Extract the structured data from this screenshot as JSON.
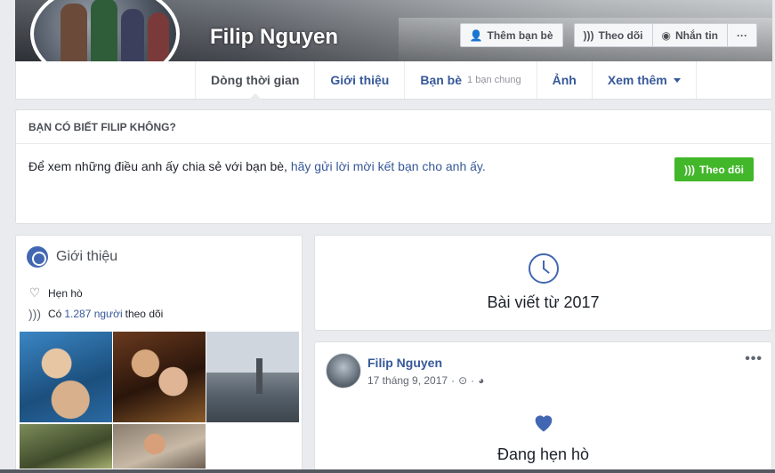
{
  "profile": {
    "name": "Filip Nguyen",
    "actions": {
      "add_friend": "Thêm bạn bè",
      "follow": "Theo dõi",
      "message": "Nhắn tin",
      "more": "···"
    }
  },
  "tabs": [
    {
      "label": "Dòng thời gian",
      "sub": ""
    },
    {
      "label": "Giới thiệu",
      "sub": ""
    },
    {
      "label": "Bạn bè",
      "sub": "1 bạn chung"
    },
    {
      "label": "Ảnh",
      "sub": ""
    },
    {
      "label": "Xem thêm",
      "sub": ""
    }
  ],
  "know": {
    "title": "BẠN CÓ BIẾT FILIP KHÔNG?",
    "text": "Để xem những điều anh ấy chia sẻ với bạn bè,",
    "link": "hãy gửi lời mời kết bạn cho anh ấy.",
    "follow_button": "Theo dõi"
  },
  "intro": {
    "title": "Giới thiệu",
    "relationship": "Hẹn hò",
    "followers_prefix": "Có",
    "followers_count": "1.287 người",
    "followers_suffix": "theo dõi"
  },
  "posts_from": {
    "label": "Bài viết từ 2017"
  },
  "post": {
    "author": "Filip Nguyen",
    "date": "17 tháng 9, 2017",
    "more": "•••",
    "status": "Đang hẹn hò"
  },
  "colors": {
    "link": "#365899",
    "green": "#42b72a",
    "accent": "#4267b2"
  }
}
